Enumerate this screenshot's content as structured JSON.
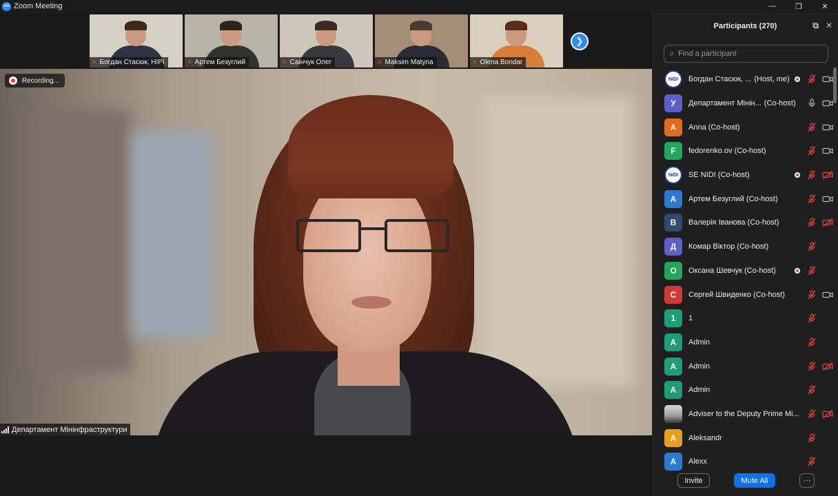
{
  "window": {
    "title": "Zoom Meeting",
    "logo_text": "zm",
    "minimize": "—",
    "maximize": "❐",
    "close": "✕"
  },
  "thumbnails": [
    {
      "name": "Богдан Стасюк, НІРІ",
      "bg": "#d7d1c5",
      "body": "#2e3444",
      "hair": "#3b2a20"
    },
    {
      "name": "Артем Безуглий",
      "bg": "#b9b3a6",
      "body": "#2f342e",
      "hair": "#2b2219"
    },
    {
      "name": "Саінчук Олег",
      "bg": "#cfc7ba",
      "body": "#3a3a3e",
      "hair": "#3a2c22"
    },
    {
      "name": "Maksim Matyna",
      "bg": "#a58e78",
      "body": "#2a2c33",
      "hair": "#4a3b30"
    },
    {
      "name": "Olena Bondar",
      "bg": "#d9d0bb",
      "body": "#d87c3a",
      "hair": "#5b2b1b"
    }
  ],
  "next_icon": "❯",
  "recording": {
    "label": "Recording..."
  },
  "speaker": {
    "name": "Департамент Мінінфраструктури"
  },
  "panel": {
    "title": "Participants (270)",
    "popout_icon": "⧉",
    "close_icon": "✕",
    "search_placeholder": "Find a participant",
    "search_icon": "⌕",
    "invite": "Invite",
    "mute_all": "Mute All",
    "more": "···"
  },
  "participants": [
    {
      "initial": "NIDI",
      "avatar": "logo",
      "color": "#ffffff",
      "name": "Богдан Стасюк, ...",
      "role": "(Host, me)",
      "rec": true,
      "mic": "off",
      "cam": "on"
    },
    {
      "initial": "У",
      "avatar": "letter",
      "color": "#5b5fc7",
      "name": "Департамент Мінін...",
      "role": "(Co-host)",
      "rec": false,
      "mic": "on",
      "cam": "on"
    },
    {
      "initial": "A",
      "avatar": "letter",
      "color": "#e56a1c",
      "name": "Anna (Co-host)",
      "role": "",
      "rec": false,
      "mic": "off",
      "cam": "on"
    },
    {
      "initial": "F",
      "avatar": "letter",
      "color": "#23a55a",
      "name": "fedorenko.ov (Co-host)",
      "role": "",
      "rec": false,
      "mic": "off",
      "cam": "on"
    },
    {
      "initial": "NIDI",
      "avatar": "logo",
      "color": "#ffffff",
      "name": "SE NIDI (Co-host)",
      "role": "",
      "rec": true,
      "mic": "off",
      "cam": "off"
    },
    {
      "initial": "А",
      "avatar": "letter",
      "color": "#2b7bd0",
      "name": "Артем Безуглий (Co-host)",
      "role": "",
      "rec": false,
      "mic": "off",
      "cam": "on"
    },
    {
      "initial": "В",
      "avatar": "letter",
      "color": "#2f4a6e",
      "name": "Валерія Іванова (Co-host)",
      "role": "",
      "rec": false,
      "mic": "off",
      "cam": "off"
    },
    {
      "initial": "Д",
      "avatar": "letter",
      "color": "#5b5fc7",
      "name": "Комар Віктор (Co-host)",
      "role": "",
      "rec": false,
      "mic": "off",
      "cam": "none"
    },
    {
      "initial": "О",
      "avatar": "letter",
      "color": "#23a55a",
      "name": "Оксана Шевчук (Co-host)",
      "role": "",
      "rec": true,
      "mic": "off",
      "cam": "none"
    },
    {
      "initial": "С",
      "avatar": "letter",
      "color": "#d03a32",
      "name": "Сергей Швиденко (Co-host)",
      "role": "",
      "rec": false,
      "mic": "off",
      "cam": "on"
    },
    {
      "initial": "1",
      "avatar": "letter",
      "color": "#1f9c78",
      "name": "1",
      "role": "",
      "rec": false,
      "mic": "off",
      "cam": "none"
    },
    {
      "initial": "A",
      "avatar": "letter",
      "color": "#1f9c78",
      "name": "Admin",
      "role": "",
      "rec": false,
      "mic": "off",
      "cam": "none"
    },
    {
      "initial": "A",
      "avatar": "letter",
      "color": "#1f9c78",
      "name": "Admin",
      "role": "",
      "rec": false,
      "mic": "off",
      "cam": "off"
    },
    {
      "initial": "A",
      "avatar": "letter",
      "color": "#1f9c78",
      "name": "Admin",
      "role": "",
      "rec": false,
      "mic": "off",
      "cam": "none"
    },
    {
      "initial": "",
      "avatar": "photo",
      "color": "#999999",
      "name": "Adviser to the Deputy Prime Mi...",
      "role": "",
      "rec": false,
      "mic": "off",
      "cam": "off"
    },
    {
      "initial": "A",
      "avatar": "letter",
      "color": "#e8a01c",
      "name": "Aleksandr",
      "role": "",
      "rec": false,
      "mic": "off",
      "cam": "none"
    },
    {
      "initial": "A",
      "avatar": "letter",
      "color": "#2b7bd0",
      "name": "Alexx",
      "role": "",
      "rec": false,
      "mic": "off",
      "cam": "none"
    }
  ]
}
